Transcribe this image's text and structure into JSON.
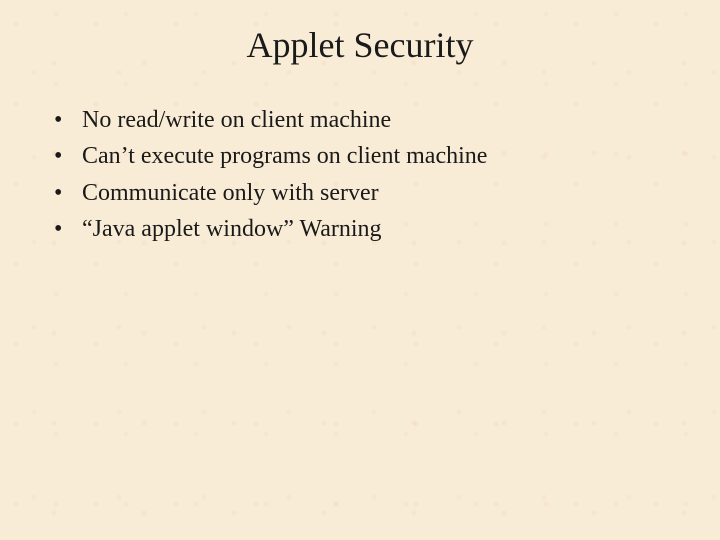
{
  "slide": {
    "title": "Applet Security",
    "bullets": [
      "No read/write on client machine",
      "Can’t execute programs on client machine",
      "Communicate only with server",
      "“Java applet window” Warning"
    ]
  }
}
